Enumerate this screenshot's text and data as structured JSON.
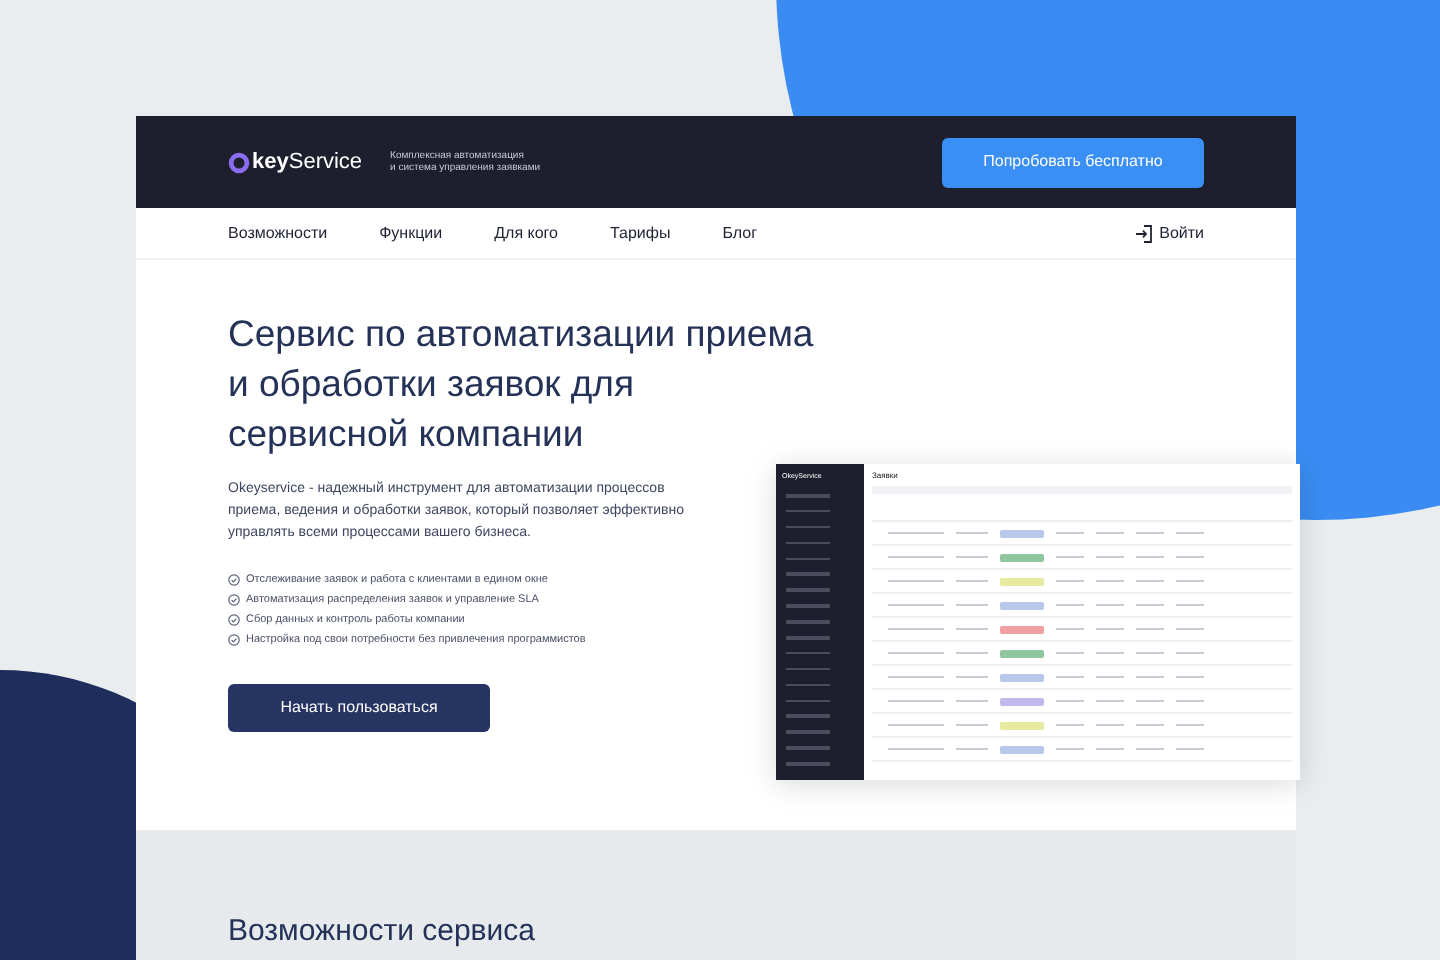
{
  "header": {
    "logo": "**key**Service",
    "tagline": [
      "Комплексная автоматизация",
      "и система управления заявками"
    ],
    "cta": "Попробовать бесплатно"
  },
  "nav": {
    "items": [
      "Возможности",
      "Функции",
      "Для кого",
      "Тарифы",
      "Блог"
    ],
    "login": "Войти"
  },
  "hero": {
    "title": "Сервис по автоматизации приема и обработки заявок для сервисной компании",
    "description": "Okeyservice - надежный инструмент для автоматизации процессов приема, ведения и обработки заявок, который позволяет эффективно управлять всеми процессами вашего бизнеса.",
    "features": [
      "Отслеживание заявок и работа с клиентами в едином окне",
      "Автоматизация распределения заявок и управление SLA",
      "Сбор данных и контроль работы компании",
      "Настройка под свои потребности без привлечения программистов"
    ],
    "button": "Начать пользоваться"
  },
  "screenshot": {
    "brand": "OkeyService",
    "title": "Заявки"
  },
  "section": {
    "title": "Возможности сервиса"
  }
}
